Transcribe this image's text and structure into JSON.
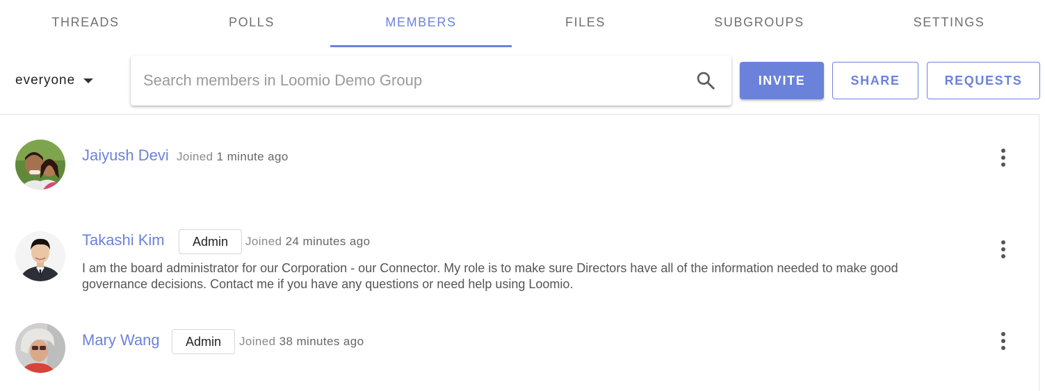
{
  "tabs": [
    {
      "label": "THREADS"
    },
    {
      "label": "POLLS"
    },
    {
      "label": "MEMBERS",
      "active": true
    },
    {
      "label": "FILES"
    },
    {
      "label": "SUBGROUPS"
    },
    {
      "label": "SETTINGS"
    }
  ],
  "toolbar": {
    "filter_label": "everyone",
    "search_placeholder": "Search members in Loomio Demo Group",
    "search_value": "",
    "invite_label": "INVITE",
    "share_label": "SHARE",
    "requests_label": "REQUESTS"
  },
  "members": [
    {
      "name": "Jaiyush Devi",
      "role": "",
      "joined_prefix": "Joined",
      "joined_time": "1 minute ago",
      "bio": ""
    },
    {
      "name": "Takashi Kim",
      "role": "Admin",
      "joined_prefix": "Joined",
      "joined_time": "24 minutes ago",
      "bio": "I am the board administrator for our Corporation - our Connector. My role is to make sure Directors have all of the information needed to make good governance decisions. Contact me if you have any questions or need help using Loomio."
    },
    {
      "name": "Mary Wang",
      "role": "Admin",
      "joined_prefix": "Joined",
      "joined_time": "38 minutes ago",
      "bio": ""
    }
  ],
  "colors": {
    "accent": "#6b82db",
    "text_muted": "#8a8a8a"
  },
  "icons": {
    "search": "search-icon",
    "more": "more-vert-icon",
    "caret": "caret-down-icon"
  }
}
